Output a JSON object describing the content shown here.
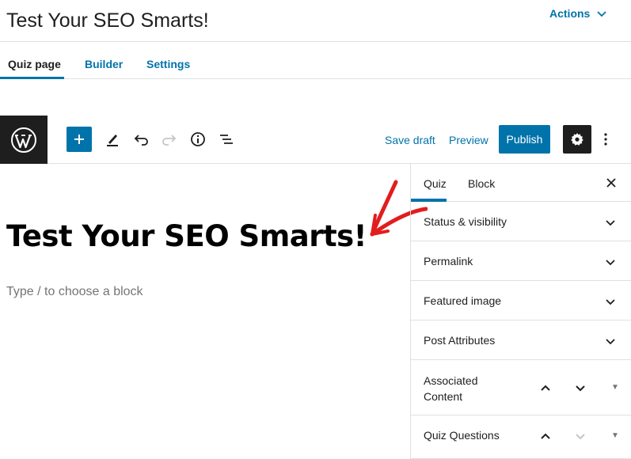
{
  "header": {
    "title": "Test Your SEO Smarts!",
    "actions_label": "Actions"
  },
  "tabs": [
    {
      "label": "Quiz page",
      "active": true
    },
    {
      "label": "Builder",
      "active": false
    },
    {
      "label": "Settings",
      "active": false
    }
  ],
  "toolbar": {
    "save_draft": "Save draft",
    "preview": "Preview",
    "publish": "Publish"
  },
  "editor": {
    "post_title": "Test Your SEO Smarts!",
    "block_placeholder": "Type / to choose a block"
  },
  "sidebar": {
    "tabs": [
      {
        "label": "Quiz",
        "active": true
      },
      {
        "label": "Block",
        "active": false
      }
    ],
    "panels": [
      {
        "label": "Status & visibility"
      },
      {
        "label": "Permalink"
      },
      {
        "label": "Featured image"
      },
      {
        "label": "Post Attributes"
      },
      {
        "label": "Associated Content"
      },
      {
        "label": "Quiz Questions"
      }
    ]
  },
  "colors": {
    "accent": "#0073aa",
    "dark": "#1e1e1e",
    "annotation": "#e21d1d"
  }
}
